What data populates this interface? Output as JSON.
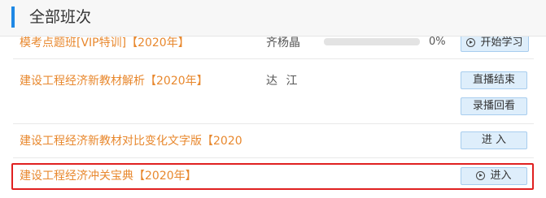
{
  "header": {
    "title": "全部班次"
  },
  "courses": [
    {
      "title": "模考点题班[VIP特训]【2020年】",
      "teacher": "齐杨晶",
      "progress_percent": 0,
      "progress_text": "0%",
      "button_label": "开始学习"
    },
    {
      "title": "建设工程经济新教材解析【2020年】",
      "teacher": "达  江",
      "buttons": [
        "直播结束",
        "录播回看"
      ]
    },
    {
      "title": "建设工程经济新教材对比变化文字版【2020",
      "button_label": "进 入"
    },
    {
      "title": "建设工程经济冲关宝典【2020年】",
      "button_label": "进入"
    }
  ],
  "colors": {
    "accent": "#1e88e5",
    "course_title": "#e8882e",
    "highlight": "#e02020",
    "button_bg": "#deeefb"
  },
  "icons": {
    "play": "play-circle-icon"
  }
}
